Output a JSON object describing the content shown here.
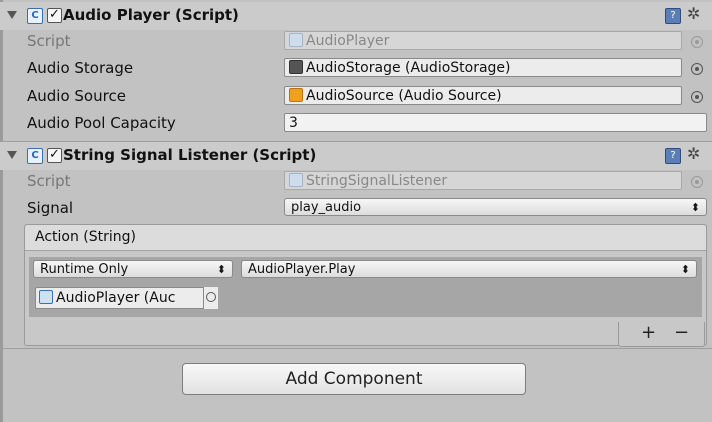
{
  "components": [
    {
      "title": "Audio Player (Script)",
      "icon": "csharp-script-icon",
      "enabled": true,
      "fields": [
        {
          "label": "Script",
          "value": "AudioPlayer",
          "dim": true
        },
        {
          "label": "Audio Storage",
          "value": "AudioStorage (AudioStorage)"
        },
        {
          "label": "Audio Source",
          "value": "AudioSource (Audio Source)"
        },
        {
          "label": "Audio Pool Capacity",
          "value": "3"
        }
      ]
    },
    {
      "title": "String Signal Listener (Script)",
      "icon": "csharp-script-icon",
      "enabled": true,
      "fields": [
        {
          "label": "Script",
          "value": "StringSignalListener",
          "dim": true
        },
        {
          "label": "Signal",
          "value": "play_audio"
        }
      ],
      "event": {
        "header": "Action (String)",
        "call_state": "Runtime Only",
        "function": "AudioPlayer.Play",
        "target": "AudioPlayer (Auc",
        "add_label": "+",
        "remove_label": "−"
      }
    }
  ],
  "add_component_label": "Add Component",
  "colors": {
    "panel_bg": "#c2c2c2",
    "header_bg": "#cbcbcb",
    "event_body": "#a6a6a6",
    "audio_source_icon": "#f0a020"
  }
}
